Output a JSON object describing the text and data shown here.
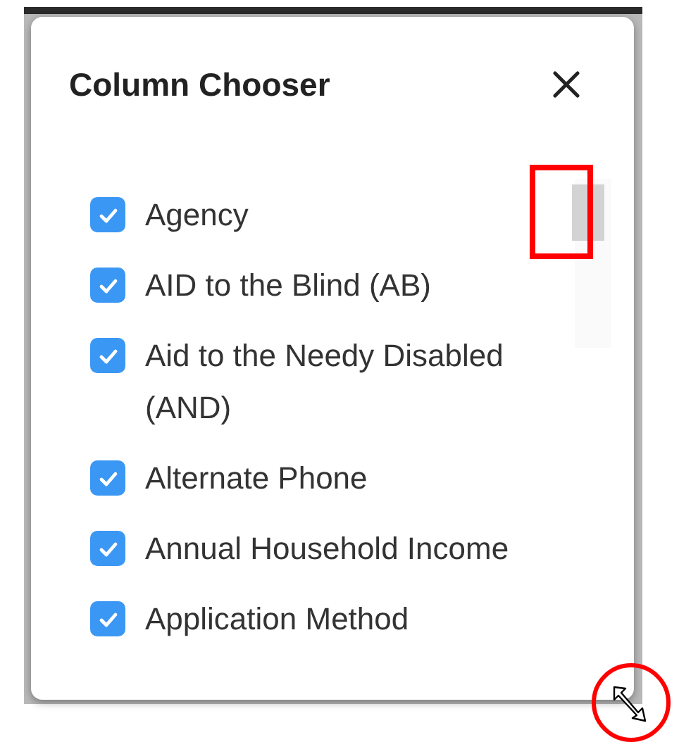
{
  "dialog": {
    "title": "Column Chooser"
  },
  "columns": [
    {
      "label": "Agency",
      "checked": true
    },
    {
      "label": "AID to the Blind (AB)",
      "checked": true
    },
    {
      "label": "Aid to the Needy Disabled (AND)",
      "checked": true
    },
    {
      "label": "Alternate Phone",
      "checked": true
    },
    {
      "label": "Annual Household Income",
      "checked": true
    },
    {
      "label": "Application Method",
      "checked": true
    }
  ]
}
